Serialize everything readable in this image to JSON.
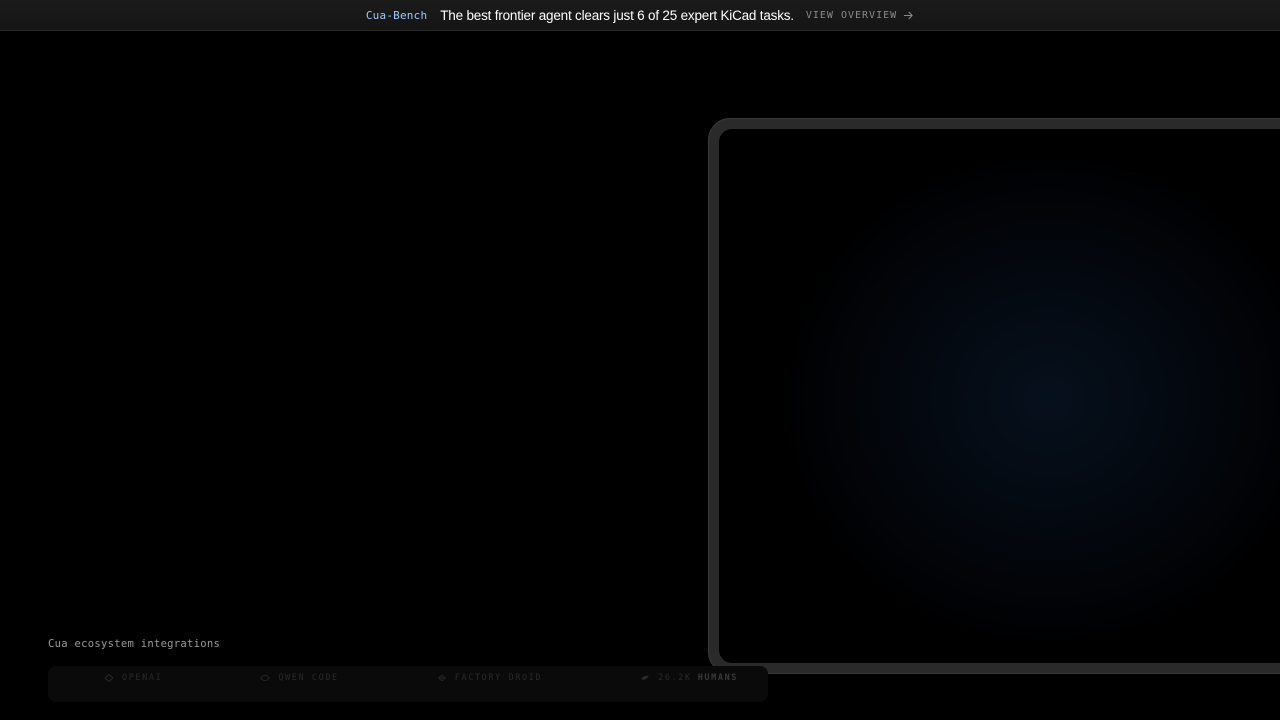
{
  "banner": {
    "tag": "Cua-Bench",
    "message": "The best frontier agent clears just 6 of 25 expert KiCad tasks.",
    "link_label": "VIEW OVERVIEW",
    "link_icon": "arrow-right-icon"
  },
  "integrations": {
    "label": "Cua ecosystem integrations",
    "items": [
      {
        "name": "OPENAI",
        "icon": "openai-icon"
      },
      {
        "name": "QWEN CODE",
        "icon": "qwen-icon"
      },
      {
        "name": "FACTORY DROID",
        "icon": "factory-icon"
      },
      {
        "name": "26.2K",
        "suffix": "HUMANS",
        "icon": "bird-icon"
      }
    ]
  },
  "colors": {
    "background": "#000000",
    "accent": "#9ec8ff",
    "banner_bg": "#181818"
  }
}
